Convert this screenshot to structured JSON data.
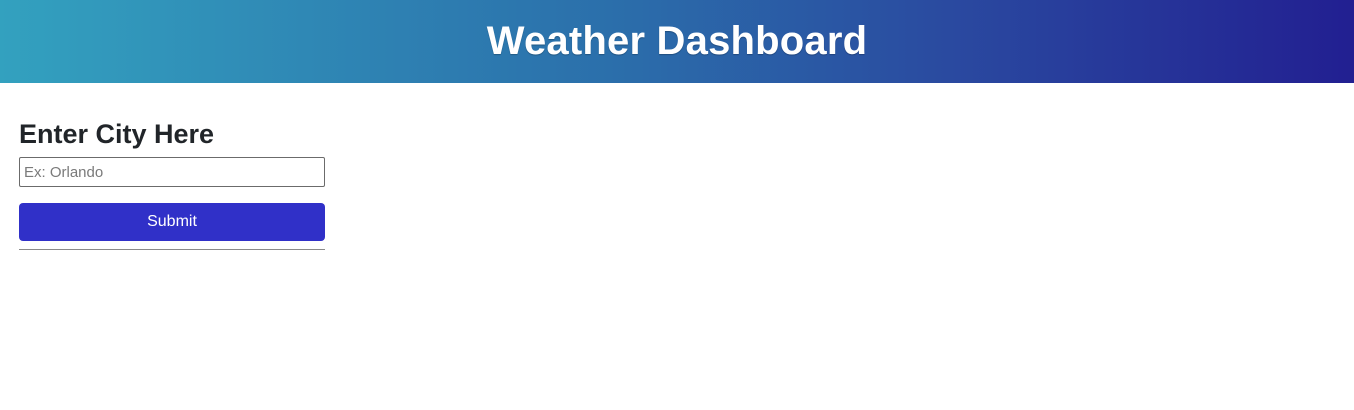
{
  "header": {
    "title": "Weather Dashboard"
  },
  "search": {
    "heading": "Enter City Here",
    "placeholder": "Ex: Orlando",
    "value": "",
    "submit_label": "Submit"
  },
  "colors": {
    "header_gradient_start": "#33a1bf",
    "header_gradient_end": "#221f91",
    "button": "#3030c8"
  }
}
